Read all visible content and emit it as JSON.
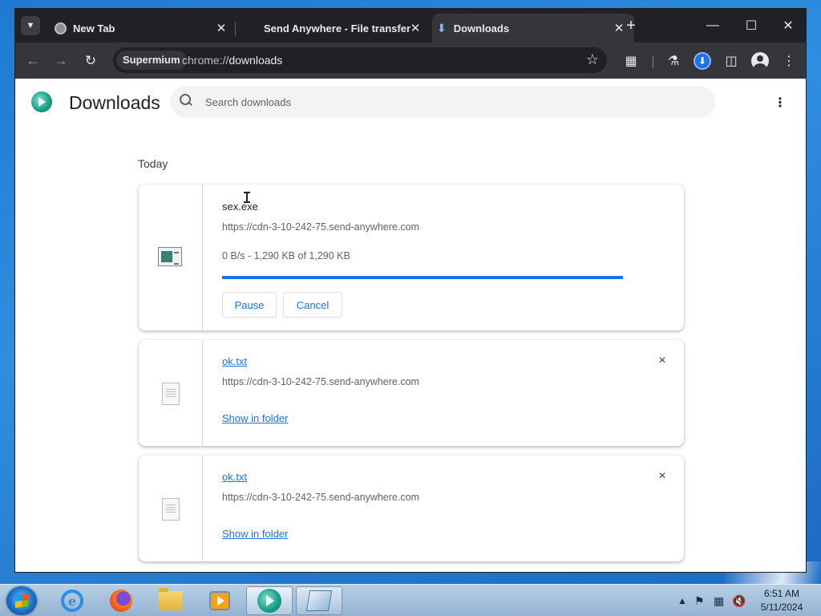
{
  "browser": {
    "tabs": [
      {
        "label": "New Tab",
        "active": false
      },
      {
        "label": "Send Anywhere - File transfer",
        "active": false
      },
      {
        "label": "Downloads",
        "active": true
      }
    ],
    "profile_chip": "Supermium",
    "url_scheme": "chrome://",
    "url_host": "downloads"
  },
  "page": {
    "title": "Downloads",
    "search_placeholder": "Search downloads",
    "date_header": "Today"
  },
  "downloads": [
    {
      "file_name": "sex.exe",
      "url": "https://cdn-3-10-242-75.send-anywhere.com",
      "status": "0 B/s - 1,290 KB of 1,290 KB",
      "progress": 1.0,
      "buttons": {
        "pause": "Pause",
        "cancel": "Cancel"
      }
    },
    {
      "file_name": "ok.txt",
      "url": "https://cdn-3-10-242-75.send-anywhere.com",
      "action": "Show in folder",
      "remove": "×"
    },
    {
      "file_name": "ok.txt",
      "url": "https://cdn-3-10-242-75.send-anywhere.com",
      "action": "Show in folder",
      "remove": "×"
    }
  ],
  "taskbar": {
    "time": "6:51 AM",
    "date": "5/11/2024"
  },
  "colors": {
    "accent": "#1a73e8",
    "tabstrip": "#202124",
    "toolbar": "#35363a"
  },
  "icons": [
    "tab-search-icon",
    "globe-icon",
    "download-icon",
    "plus-icon",
    "minimize-icon",
    "maximize-icon",
    "close-icon",
    "back-icon",
    "forward-icon",
    "reload-icon",
    "star-icon",
    "extensions-icon",
    "labs-icon",
    "downloads-toolbar-icon",
    "side-panel-icon",
    "profile-icon",
    "menu-icon",
    "search-icon"
  ]
}
